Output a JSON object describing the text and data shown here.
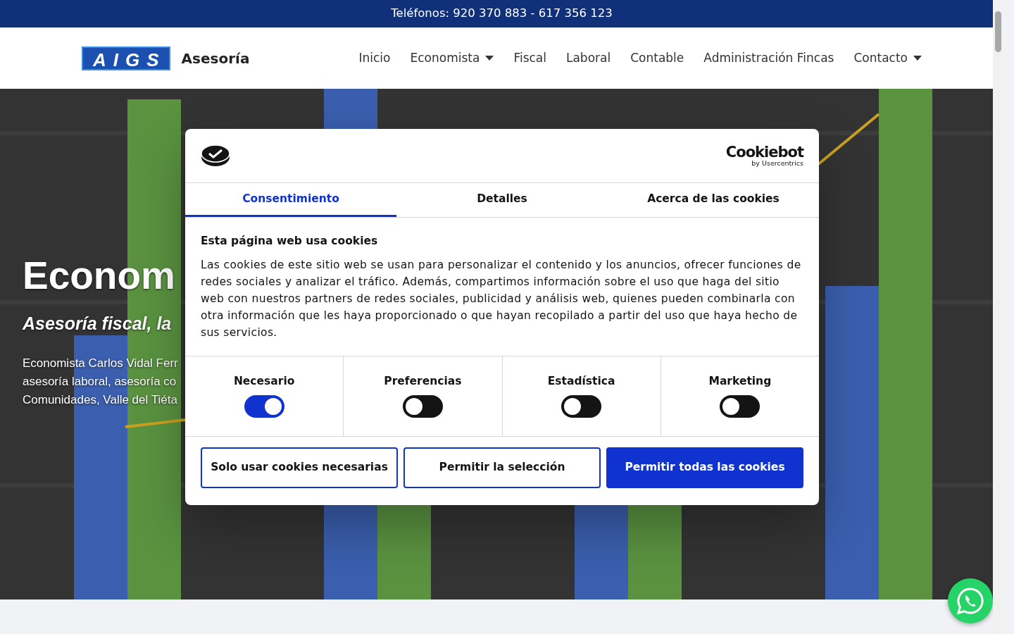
{
  "top_bar": {
    "text": "Teléfonos: 920 370 883 - 617 356 123"
  },
  "navbar": {
    "logo": "AIGS",
    "brand": "Asesoría",
    "items": [
      {
        "label": "Inicio",
        "dropdown": false
      },
      {
        "label": "Economista",
        "dropdown": true
      },
      {
        "label": "Fiscal",
        "dropdown": false
      },
      {
        "label": "Laboral",
        "dropdown": false
      },
      {
        "label": "Contable",
        "dropdown": false
      },
      {
        "label": "Administración Fincas",
        "dropdown": false
      },
      {
        "label": "Contacto",
        "dropdown": true
      }
    ]
  },
  "hero": {
    "title": "Econom",
    "subtitle": "Asesoría fiscal, la",
    "lines": [
      "Economista Carlos Vidal Ferr",
      "asesoría laboral, asesoría co",
      "Comunidades, Valle del Tiéta"
    ]
  },
  "cookie_dialog": {
    "brand": "Cookiebot",
    "brand_sub": "by Usercentrics",
    "tabs": [
      {
        "label": "Consentimiento",
        "selected": true
      },
      {
        "label": "Detalles",
        "selected": false
      },
      {
        "label": "Acerca de las cookies",
        "selected": false
      }
    ],
    "heading": "Esta página web usa cookies",
    "text": "Las cookies de este sitio web se usan para personalizar el contenido y los anuncios, ofrecer funciones de redes sociales y analizar el tráfico. Además, compartimos información sobre el uso que haga del sitio web con nuestros partners de redes sociales, publicidad y análisis web, quienes pueden combinarla con otra información que les haya proporcionado o que hayan recopilado a partir del uso que haya hecho de sus servicios.",
    "toggles": [
      {
        "label": "Necesario",
        "on": true
      },
      {
        "label": "Preferencias",
        "on": false
      },
      {
        "label": "Estadística",
        "on": false
      },
      {
        "label": "Marketing",
        "on": false
      }
    ],
    "buttons": [
      {
        "label": "Solo usar cookies necesarias",
        "kind": "outline"
      },
      {
        "label": "Permitir la selección",
        "kind": "outline"
      },
      {
        "label": "Permitir todas las cookies",
        "kind": "primary"
      }
    ]
  }
}
